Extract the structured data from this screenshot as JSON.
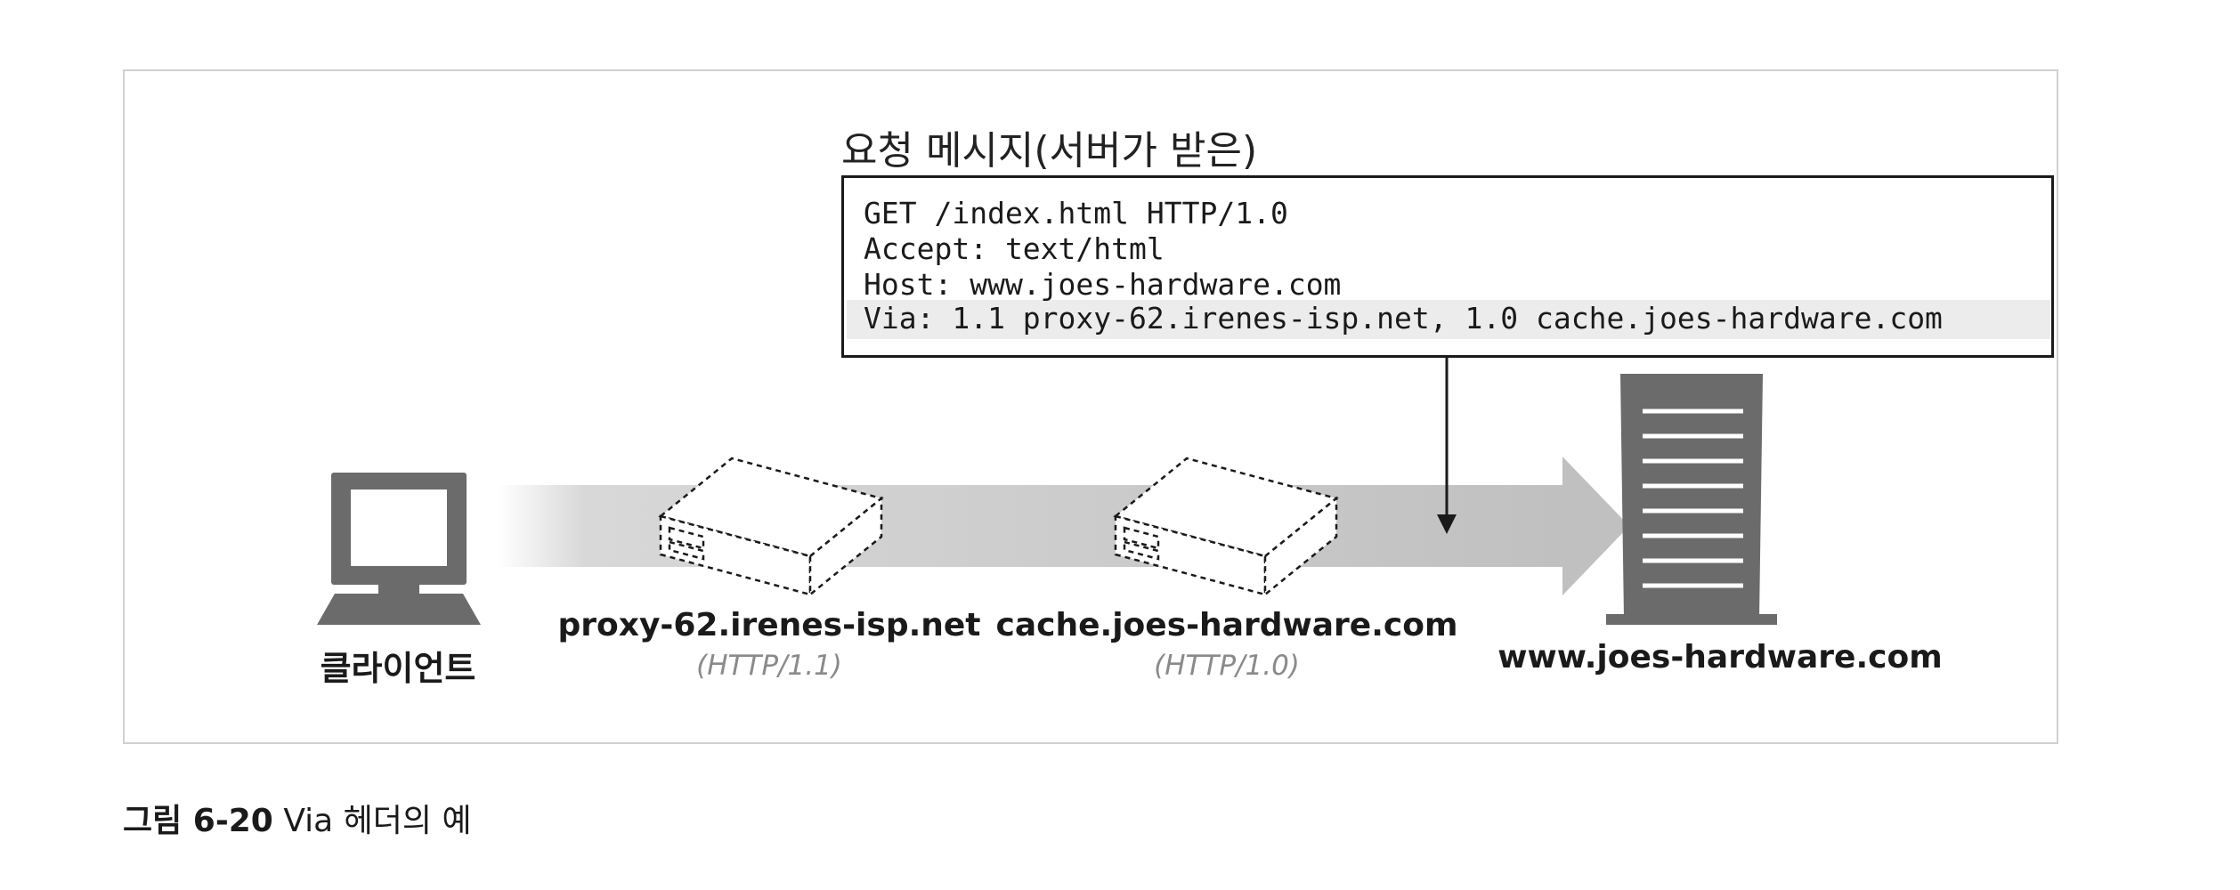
{
  "message": {
    "title": "요청 메시지(서버가 받은)",
    "lines": [
      "GET /index.html HTTP/1.0",
      "Accept: text/html",
      "Host: www.joes-hardware.com",
      "Via: 1.1 proxy-62.irenes-isp.net, 1.0 cache.joes-hardware.com"
    ]
  },
  "nodes": {
    "client": {
      "label": "클라이언트",
      "icon": "computer-monitor-icon"
    },
    "proxy": {
      "label": "proxy-62.irenes-isp.net",
      "protocol": "(HTTP/1.1)",
      "icon": "proxy-box-icon"
    },
    "cache": {
      "label": "cache.joes-hardware.com",
      "protocol": "(HTTP/1.0)",
      "icon": "cache-box-icon"
    },
    "server": {
      "label": "www.joes-hardware.com",
      "icon": "server-tower-icon"
    }
  },
  "caption": {
    "lead": "그림 6-20",
    "text": "Via 헤더의 예"
  },
  "colors": {
    "flow_arrow": "#c8c8c8",
    "device_dark": "#6b6b6b",
    "highlight_row": "#ececec"
  }
}
